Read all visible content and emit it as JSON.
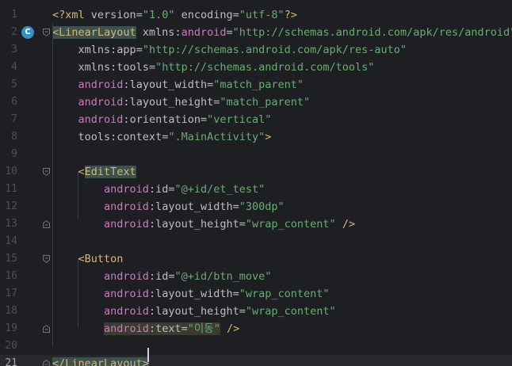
{
  "editor": {
    "language": "XML",
    "current_line": 21,
    "gutter_icon_label": "C",
    "colors": {
      "background": "#1e1f22",
      "current_line": "#26282e",
      "tag": "#d5b778",
      "namespace": "#c77dbb",
      "string": "#6aab73",
      "plain": "#bcbec4",
      "line_number": "#4b5059"
    },
    "lines": [
      {
        "n": "1",
        "tokens": [
          [
            "t-pi",
            "<?xml "
          ],
          [
            "t-attr",
            "version"
          ],
          [
            "t-plain",
            "="
          ],
          [
            "t-val",
            "\"1.0\""
          ],
          [
            "t-attr",
            " encoding"
          ],
          [
            "t-plain",
            "="
          ],
          [
            "t-val",
            "\"utf-8\""
          ],
          [
            "t-pi",
            "?>"
          ]
        ]
      },
      {
        "n": "2",
        "tokens": [
          [
            "t-tag-hl",
            "<LinearLayout"
          ],
          [
            "t-attr",
            " xmlns"
          ],
          [
            "t-plain",
            ":"
          ],
          [
            "t-ns",
            "android"
          ],
          [
            "t-plain",
            "="
          ],
          [
            "t-val",
            "\"http://schemas.android.com/apk/res/android\""
          ]
        ]
      },
      {
        "n": "3",
        "tokens": [
          [
            "t-plain",
            "    "
          ],
          [
            "t-attr",
            "xmlns"
          ],
          [
            "t-plain",
            ":"
          ],
          [
            "t-attr",
            "app"
          ],
          [
            "t-plain",
            "="
          ],
          [
            "t-val",
            "\"http://schemas.android.com/apk/res-auto\""
          ]
        ]
      },
      {
        "n": "4",
        "tokens": [
          [
            "t-plain",
            "    "
          ],
          [
            "t-attr",
            "xmlns"
          ],
          [
            "t-plain",
            ":"
          ],
          [
            "t-attr",
            "tools"
          ],
          [
            "t-plain",
            "="
          ],
          [
            "t-val",
            "\"http://schemas.android.com/tools\""
          ]
        ]
      },
      {
        "n": "5",
        "tokens": [
          [
            "t-plain",
            "    "
          ],
          [
            "t-ns",
            "android"
          ],
          [
            "t-plain",
            ":"
          ],
          [
            "t-attr",
            "layout_width"
          ],
          [
            "t-plain",
            "="
          ],
          [
            "t-val",
            "\"match_parent\""
          ]
        ]
      },
      {
        "n": "6",
        "tokens": [
          [
            "t-plain",
            "    "
          ],
          [
            "t-ns",
            "android"
          ],
          [
            "t-plain",
            ":"
          ],
          [
            "t-attr",
            "layout_height"
          ],
          [
            "t-plain",
            "="
          ],
          [
            "t-val",
            "\"match_parent\""
          ]
        ]
      },
      {
        "n": "7",
        "tokens": [
          [
            "t-plain",
            "    "
          ],
          [
            "t-ns",
            "android"
          ],
          [
            "t-plain",
            ":"
          ],
          [
            "t-attr",
            "orientation"
          ],
          [
            "t-plain",
            "="
          ],
          [
            "t-val",
            "\"vertical\""
          ]
        ]
      },
      {
        "n": "8",
        "tokens": [
          [
            "t-plain",
            "    "
          ],
          [
            "t-attr",
            "tools"
          ],
          [
            "t-plain",
            ":"
          ],
          [
            "t-attr",
            "context"
          ],
          [
            "t-plain",
            "="
          ],
          [
            "t-val",
            "\".MainActivity\""
          ],
          [
            "t-tag",
            ">"
          ]
        ]
      },
      {
        "n": "9",
        "tokens": []
      },
      {
        "n": "10",
        "tokens": [
          [
            "t-plain",
            "    "
          ],
          [
            "t-tag",
            "<"
          ],
          [
            "t-tag-hl",
            "EditText"
          ]
        ]
      },
      {
        "n": "11",
        "tokens": [
          [
            "t-plain",
            "        "
          ],
          [
            "t-ns",
            "android"
          ],
          [
            "t-plain",
            ":"
          ],
          [
            "t-attr",
            "id"
          ],
          [
            "t-plain",
            "="
          ],
          [
            "t-val",
            "\"@+id/et_test\""
          ]
        ]
      },
      {
        "n": "12",
        "tokens": [
          [
            "t-plain",
            "        "
          ],
          [
            "t-ns",
            "android"
          ],
          [
            "t-plain",
            ":"
          ],
          [
            "t-attr",
            "layout_width"
          ],
          [
            "t-plain",
            "="
          ],
          [
            "t-val",
            "\"300dp\""
          ]
        ]
      },
      {
        "n": "13",
        "tokens": [
          [
            "t-plain",
            "        "
          ],
          [
            "t-ns",
            "android"
          ],
          [
            "t-plain",
            ":"
          ],
          [
            "t-attr",
            "layout_height"
          ],
          [
            "t-plain",
            "="
          ],
          [
            "t-val",
            "\"wrap_content\""
          ],
          [
            "t-tag",
            " />"
          ]
        ]
      },
      {
        "n": "14",
        "tokens": []
      },
      {
        "n": "15",
        "tokens": [
          [
            "t-plain",
            "    "
          ],
          [
            "t-tag",
            "<Button"
          ]
        ]
      },
      {
        "n": "16",
        "tokens": [
          [
            "t-plain",
            "        "
          ],
          [
            "t-ns",
            "android"
          ],
          [
            "t-plain",
            ":"
          ],
          [
            "t-attr",
            "id"
          ],
          [
            "t-plain",
            "="
          ],
          [
            "t-val",
            "\"@+id/btn_move\""
          ]
        ]
      },
      {
        "n": "17",
        "tokens": [
          [
            "t-plain",
            "        "
          ],
          [
            "t-ns",
            "android"
          ],
          [
            "t-plain",
            ":"
          ],
          [
            "t-attr",
            "layout_width"
          ],
          [
            "t-plain",
            "="
          ],
          [
            "t-val",
            "\"wrap_content\""
          ]
        ]
      },
      {
        "n": "18",
        "tokens": [
          [
            "t-plain",
            "        "
          ],
          [
            "t-ns",
            "android"
          ],
          [
            "t-plain",
            ":"
          ],
          [
            "t-attr",
            "layout_height"
          ],
          [
            "t-plain",
            "="
          ],
          [
            "t-val",
            "\"wrap_content\""
          ]
        ]
      },
      {
        "n": "19",
        "tokens": [
          [
            "t-plain",
            "        "
          ],
          [
            "t-ns t-hl-bg",
            "android"
          ],
          [
            "t-plain t-hl-bg",
            ":"
          ],
          [
            "t-attr t-hl-bg",
            "text"
          ],
          [
            "t-plain t-hl-bg",
            "="
          ],
          [
            "t-val t-hl-bg",
            "\"이동\""
          ],
          [
            "t-tag",
            " />"
          ]
        ]
      },
      {
        "n": "20",
        "tokens": []
      },
      {
        "n": "21",
        "tokens": [
          [
            "t-tag t-end-hl",
            "</LinearLayout>"
          ]
        ]
      }
    ]
  }
}
